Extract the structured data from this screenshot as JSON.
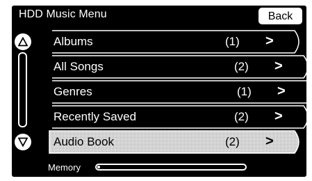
{
  "header": {
    "title": "HDD Music Menu",
    "back_label": "Back"
  },
  "menu": {
    "items": [
      {
        "label": "Albums",
        "count": "(1)",
        "chevron": ">"
      },
      {
        "label": "All Songs",
        "count": "(2)",
        "chevron": ">"
      },
      {
        "label": "Genres",
        "count": "(1)",
        "chevron": ">"
      },
      {
        "label": "Recently Saved",
        "count": "(2)",
        "chevron": ">"
      },
      {
        "label": "Audio Book",
        "count": "(2)",
        "chevron": ">",
        "selected": true
      }
    ]
  },
  "scrollbar": {
    "up_icon": "triangle-up-icon",
    "down_icon": "triangle-down-icon"
  },
  "memory": {
    "label": "Memory",
    "used_fraction": 0.02
  },
  "colors": {
    "background": "#000000",
    "foreground": "#ffffff",
    "selected_fill": "#d0d0d0"
  }
}
